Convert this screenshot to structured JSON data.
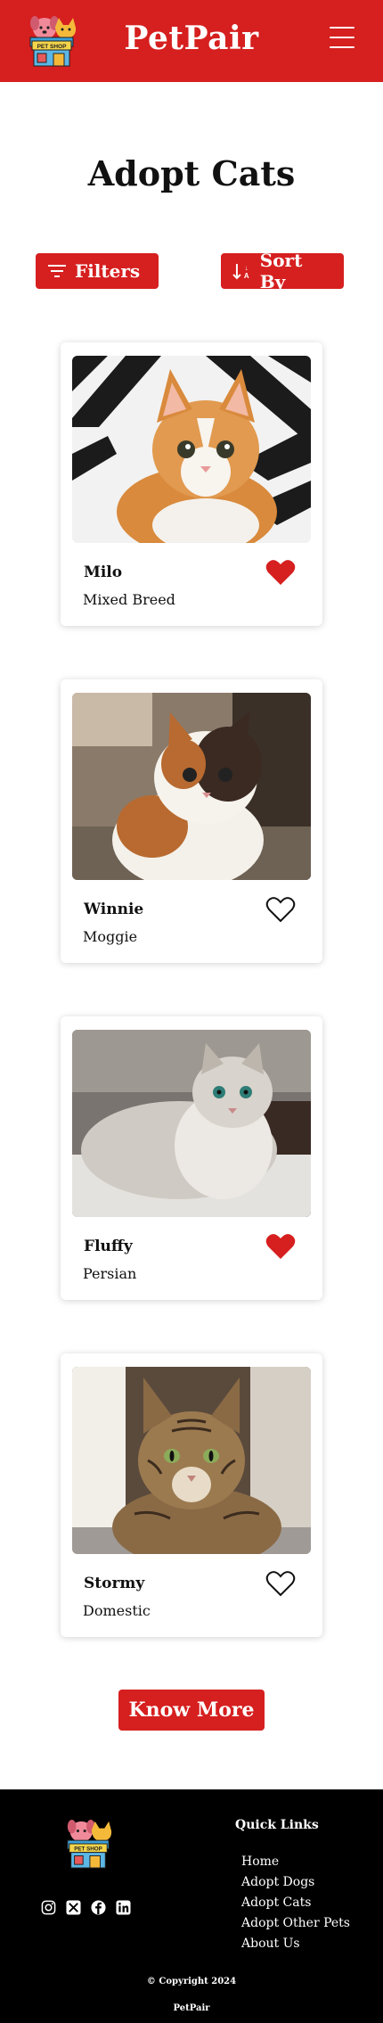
{
  "header": {
    "logo_text": "PET SHOP",
    "brand": "PetPair",
    "menu_icon": "hamburger-menu-icon"
  },
  "main": {
    "title": "Adopt Cats",
    "filters_label": "Filters",
    "sort_label": "Sort By",
    "cards": [
      {
        "name": "Milo",
        "breed": "Mixed Breed",
        "favorited": true
      },
      {
        "name": "Winnie",
        "breed": "Moggie",
        "favorited": false
      },
      {
        "name": "Fluffy",
        "breed": "Persian",
        "favorited": true
      },
      {
        "name": "Stormy",
        "breed": "Domestic",
        "favorited": false
      }
    ],
    "know_more_label": "Know More"
  },
  "footer": {
    "logo_text": "PET SHOP",
    "quick_links_title": "Quick Links",
    "quick_links": [
      "Home",
      "Adopt Dogs",
      "Adopt Cats",
      "Adopt Other Pets",
      "About Us"
    ],
    "copyright": "© Copyright 2024",
    "brand": "PetPair",
    "social_icons": [
      "instagram-icon",
      "x-icon",
      "facebook-icon",
      "linkedin-icon"
    ]
  },
  "colors": {
    "brand_red": "#d61f1f",
    "footer_bg": "#000000"
  }
}
